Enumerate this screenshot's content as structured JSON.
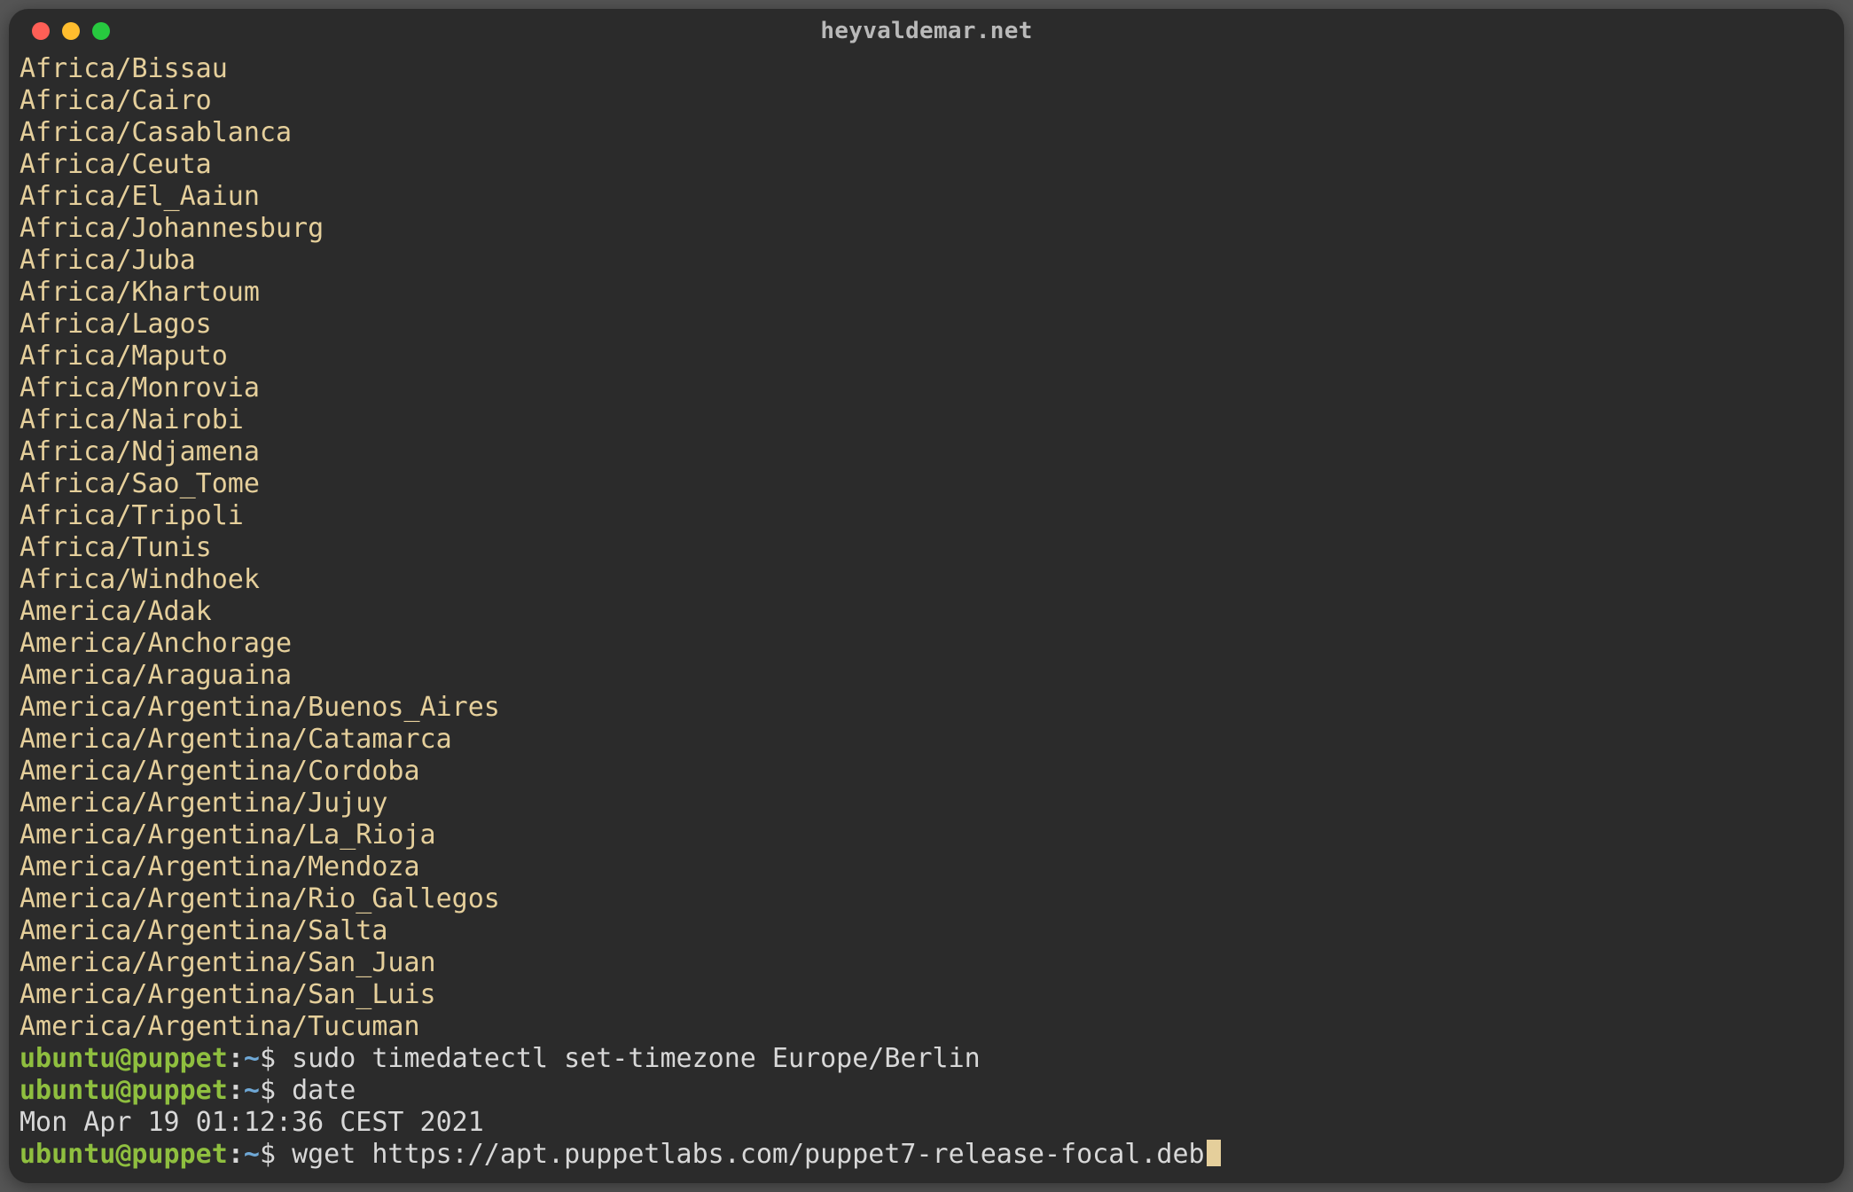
{
  "window": {
    "title": "heyvaldemar.net"
  },
  "timezones": [
    "Africa/Bissau",
    "Africa/Cairo",
    "Africa/Casablanca",
    "Africa/Ceuta",
    "Africa/El_Aaiun",
    "Africa/Johannesburg",
    "Africa/Juba",
    "Africa/Khartoum",
    "Africa/Lagos",
    "Africa/Maputo",
    "Africa/Monrovia",
    "Africa/Nairobi",
    "Africa/Ndjamena",
    "Africa/Sao_Tome",
    "Africa/Tripoli",
    "Africa/Tunis",
    "Africa/Windhoek",
    "America/Adak",
    "America/Anchorage",
    "America/Araguaina",
    "America/Argentina/Buenos_Aires",
    "America/Argentina/Catamarca",
    "America/Argentina/Cordoba",
    "America/Argentina/Jujuy",
    "America/Argentina/La_Rioja",
    "America/Argentina/Mendoza",
    "America/Argentina/Rio_Gallegos",
    "America/Argentina/Salta",
    "America/Argentina/San_Juan",
    "America/Argentina/San_Luis",
    "America/Argentina/Tucuman"
  ],
  "prompt": {
    "user": "ubuntu",
    "host": "puppet",
    "sep_userhost": "@",
    "colon": ":",
    "path": "~",
    "dollar": "$"
  },
  "history": [
    {
      "cmd": "sudo timedatectl set-timezone Europe/Berlin"
    },
    {
      "cmd": "date",
      "output": "Mon Apr 19 01:12:36 CEST 2021"
    }
  ],
  "current_cmd": "wget https://apt.puppetlabs.com/puppet7-release-focal.deb"
}
